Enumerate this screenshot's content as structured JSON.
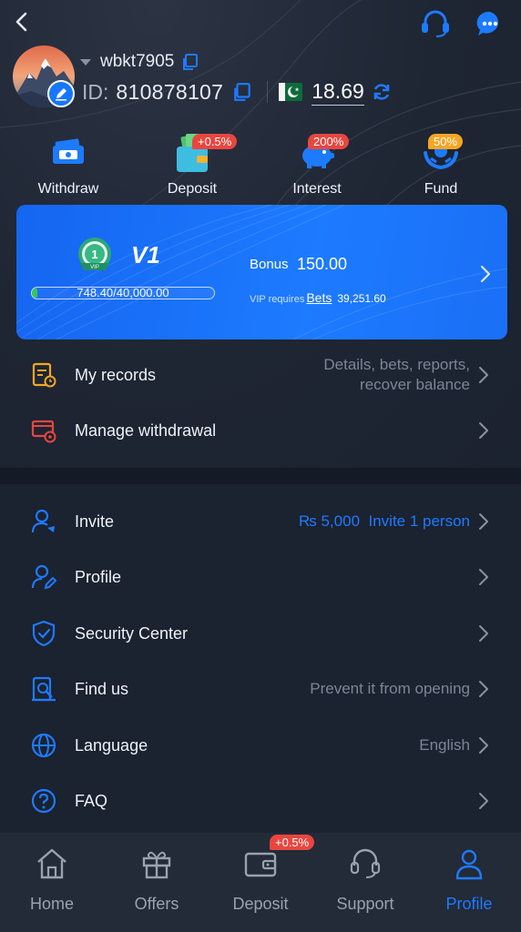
{
  "header": {
    "back_icon": "chevron-left-icon",
    "support_icon": "headset-icon",
    "chat_icon": "chat-bubble-icon"
  },
  "profile": {
    "username": "wbkt7905",
    "id_label": "ID:",
    "id_value": "810878107",
    "balance": "18.69",
    "flag": "pakistan-flag-icon"
  },
  "quick_actions": [
    {
      "label": "Withdraw",
      "icon": "ticket-icon",
      "badge": ""
    },
    {
      "label": "Deposit",
      "icon": "wallet-money-icon",
      "badge": "+0.5%"
    },
    {
      "label": "Interest",
      "icon": "piggy-bank-icon",
      "badge": "200%"
    },
    {
      "label": "Fund",
      "icon": "hands-coin-icon",
      "badge": "50%"
    }
  ],
  "vip": {
    "medal_number": "1",
    "medal_text": "VIP",
    "level": "V1",
    "progress_text": "748.40/40,000.00",
    "progress_fraction": 0.0187,
    "bonus_label": "Bonus",
    "bonus_value": "150.00",
    "requires_label": "VIP requires",
    "requires_link": "Bets",
    "requires_value": "39,251.60"
  },
  "menu_top": [
    {
      "label": "My records",
      "hint_line1": "Details, bets, reports,",
      "hint_line2": "recover balance",
      "icon": "records-icon"
    },
    {
      "label": "Manage withdrawal",
      "hint_line1": "",
      "hint_line2": "",
      "icon": "card-settings-icon"
    }
  ],
  "menu_bottom": [
    {
      "label": "Invite",
      "amount": "₨ 5,000",
      "hint": "Invite 1 person",
      "icon": "invite-user-icon"
    },
    {
      "label": "Profile",
      "hint": "",
      "icon": "user-edit-icon"
    },
    {
      "label": "Security Center",
      "hint": "",
      "icon": "shield-check-icon"
    },
    {
      "label": "Find us",
      "hint": "Prevent it from opening",
      "icon": "building-search-icon"
    },
    {
      "label": "Language",
      "hint": "English",
      "icon": "globe-icon"
    },
    {
      "label": "FAQ",
      "hint": "",
      "icon": "question-circle-icon"
    }
  ],
  "bottom_nav": [
    {
      "label": "Home",
      "icon": "home-icon",
      "badge": ""
    },
    {
      "label": "Offers",
      "icon": "gift-icon",
      "badge": ""
    },
    {
      "label": "Deposit",
      "icon": "wallet-icon",
      "badge": "+0.5%"
    },
    {
      "label": "Support",
      "icon": "headset-icon",
      "badge": ""
    },
    {
      "label": "Profile",
      "icon": "user-icon",
      "badge": "",
      "active": true
    }
  ],
  "colors": {
    "accent": "#1d7bff",
    "background": "#1b2230",
    "badge_red": "#e8463f",
    "badge_orange": "#f5a623",
    "progress_green": "#35c759"
  }
}
